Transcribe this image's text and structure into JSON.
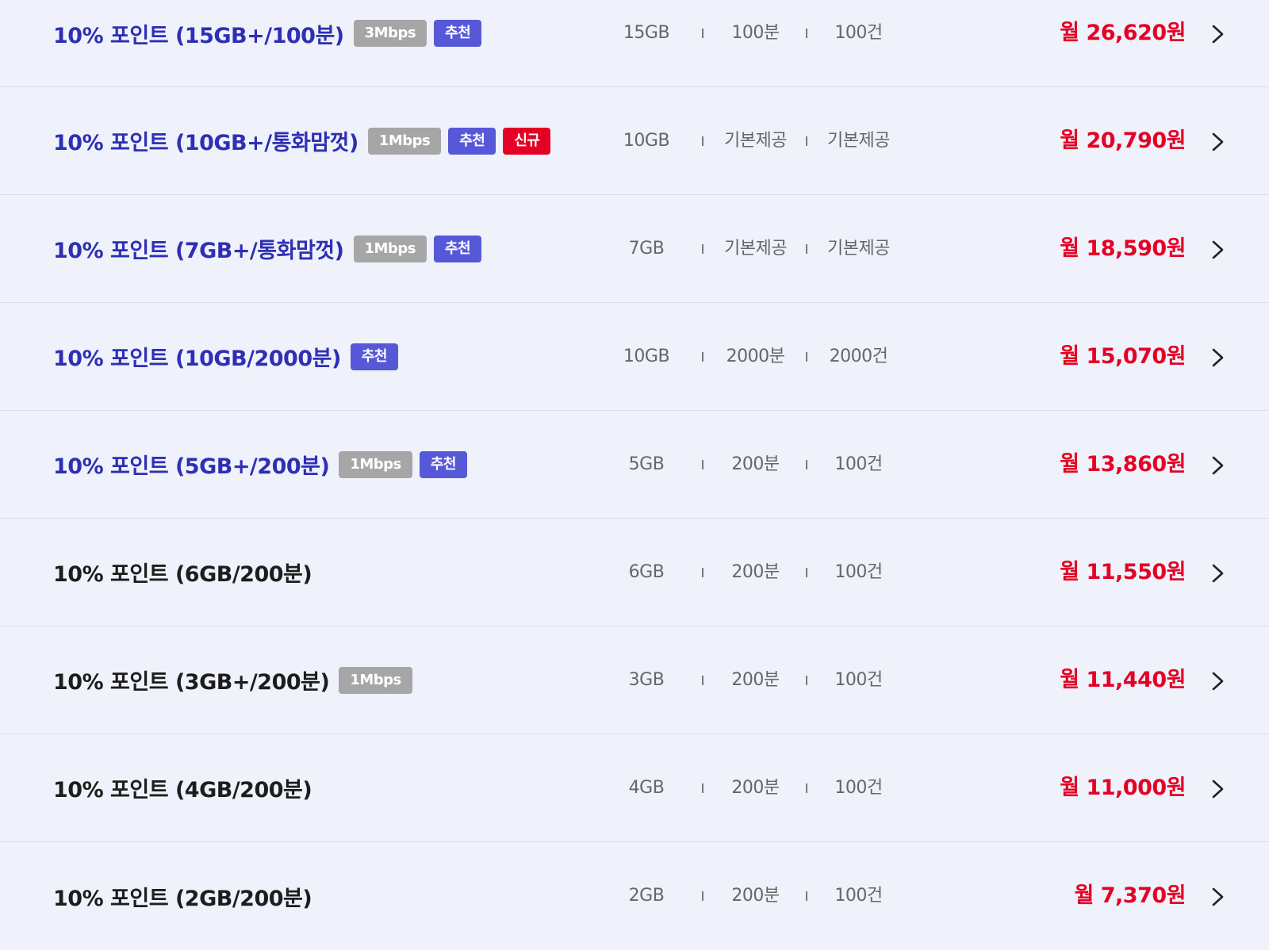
{
  "plans": [
    {
      "name": "10% 포인트 (15GB+/100분)",
      "highlight": true,
      "badges": [
        {
          "label": "3Mbps",
          "kind": "speed"
        },
        {
          "label": "추천",
          "kind": "recommend"
        }
      ],
      "data": "15GB",
      "voice": "100분",
      "sms": "100건",
      "price": "월 26,620원"
    },
    {
      "name": "10% 포인트 (10GB+/통화맘껏)",
      "highlight": true,
      "badges": [
        {
          "label": "1Mbps",
          "kind": "speed"
        },
        {
          "label": "추천",
          "kind": "recommend"
        },
        {
          "label": "신규",
          "kind": "new"
        }
      ],
      "data": "10GB",
      "voice": "기본제공",
      "sms": "기본제공",
      "price": "월 20,790원"
    },
    {
      "name": "10% 포인트 (7GB+/통화맘껏)",
      "highlight": true,
      "badges": [
        {
          "label": "1Mbps",
          "kind": "speed"
        },
        {
          "label": "추천",
          "kind": "recommend"
        }
      ],
      "data": "7GB",
      "voice": "기본제공",
      "sms": "기본제공",
      "price": "월 18,590원"
    },
    {
      "name": "10% 포인트 (10GB/2000분)",
      "highlight": true,
      "badges": [
        {
          "label": "추천",
          "kind": "recommend"
        }
      ],
      "data": "10GB",
      "voice": "2000분",
      "sms": "2000건",
      "price": "월 15,070원"
    },
    {
      "name": "10% 포인트 (5GB+/200분)",
      "highlight": true,
      "badges": [
        {
          "label": "1Mbps",
          "kind": "speed"
        },
        {
          "label": "추천",
          "kind": "recommend"
        }
      ],
      "data": "5GB",
      "voice": "200분",
      "sms": "100건",
      "price": "월 13,860원"
    },
    {
      "name": "10% 포인트 (6GB/200분)",
      "highlight": false,
      "badges": [],
      "data": "6GB",
      "voice": "200분",
      "sms": "100건",
      "price": "월 11,550원"
    },
    {
      "name": "10% 포인트 (3GB+/200분)",
      "highlight": false,
      "badges": [
        {
          "label": "1Mbps",
          "kind": "speed"
        }
      ],
      "data": "3GB",
      "voice": "200분",
      "sms": "100건",
      "price": "월 11,440원"
    },
    {
      "name": "10% 포인트 (4GB/200분)",
      "highlight": false,
      "badges": [],
      "data": "4GB",
      "voice": "200분",
      "sms": "100건",
      "price": "월 11,000원"
    },
    {
      "name": "10% 포인트 (2GB/200분)",
      "highlight": false,
      "badges": [],
      "data": "2GB",
      "voice": "200분",
      "sms": "100건",
      "price": "월 7,370원"
    }
  ],
  "colors": {
    "background": "#eff2fb",
    "highlight_name": "#2e2fb4",
    "normal_name": "#1d1d1d",
    "price": "#e50025",
    "badge_speed": "#a6a6a6",
    "badge_recommend": "#5658d8",
    "badge_new": "#e50025"
  },
  "icons": {
    "row_arrow": "chevron-right-icon"
  }
}
